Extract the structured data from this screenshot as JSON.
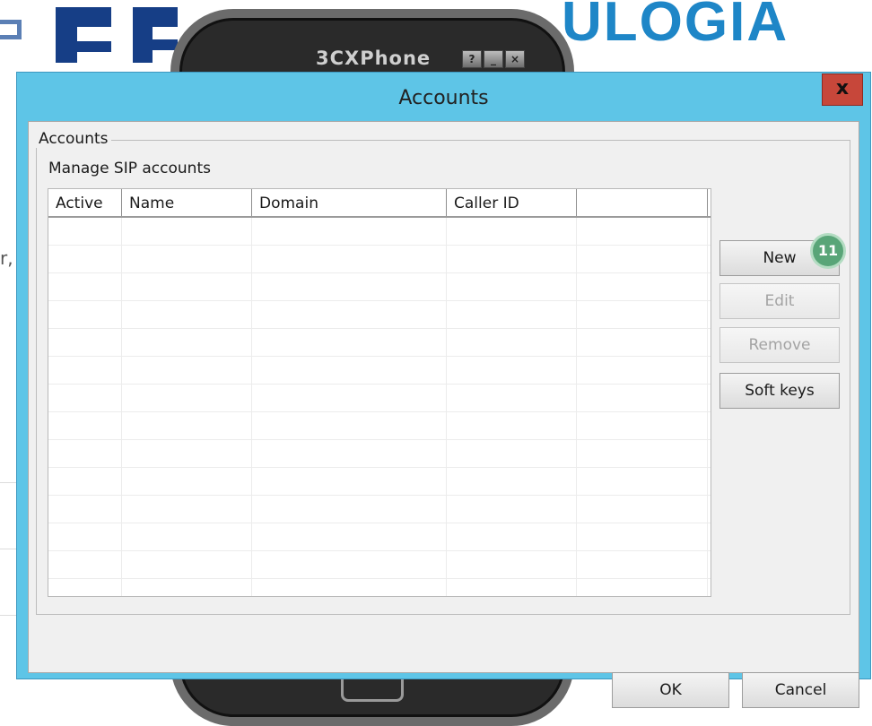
{
  "background": {
    "logo_text": "ULOGIA",
    "side_text": "r,"
  },
  "phone": {
    "title": "3CXPhone",
    "buttons": [
      "?",
      "_",
      "×"
    ]
  },
  "dialog": {
    "title": "Accounts",
    "close_label": "x",
    "group_label": "Accounts",
    "subtitle": "Manage SIP accounts",
    "table": {
      "columns": [
        "Active",
        "Name",
        "Domain",
        "Caller ID",
        ""
      ],
      "rows": []
    },
    "buttons": {
      "new_label": "New",
      "edit_label": "Edit",
      "remove_label": "Remove",
      "softkeys_label": "Soft keys",
      "ok_label": "OK",
      "cancel_label": "Cancel"
    },
    "step_badge": "11"
  }
}
